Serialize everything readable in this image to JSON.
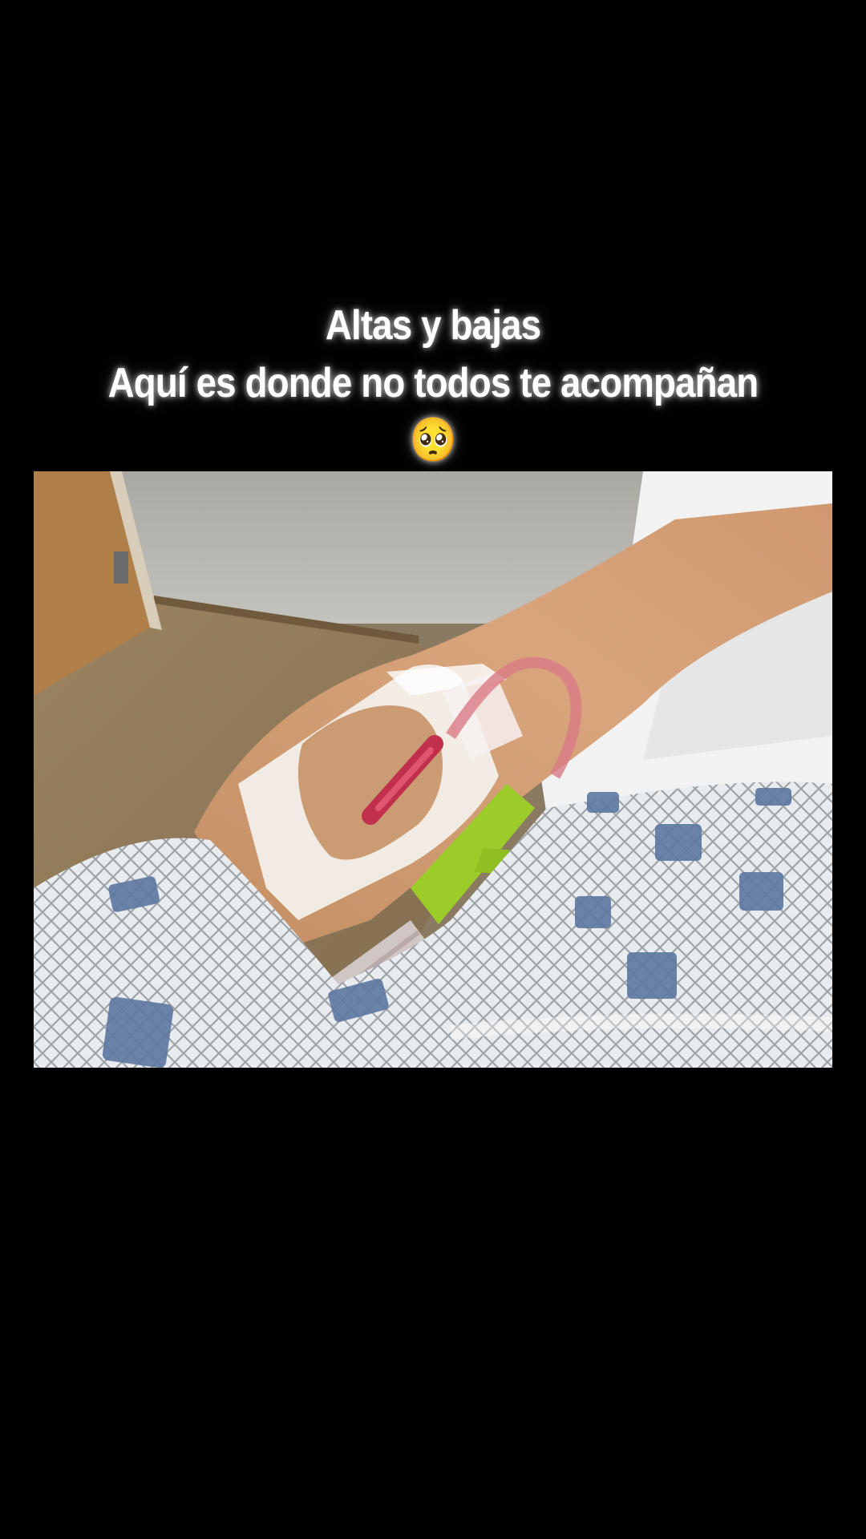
{
  "caption": {
    "line1": "Altas y bajas",
    "line2": "Aquí es donde no todos te acompañan",
    "emoji": "🥺"
  },
  "colors": {
    "background": "#000000",
    "caption_text": "#ffffff"
  },
  "photo": {
    "subject": "hospital-arm-iv-catheter-photo"
  }
}
